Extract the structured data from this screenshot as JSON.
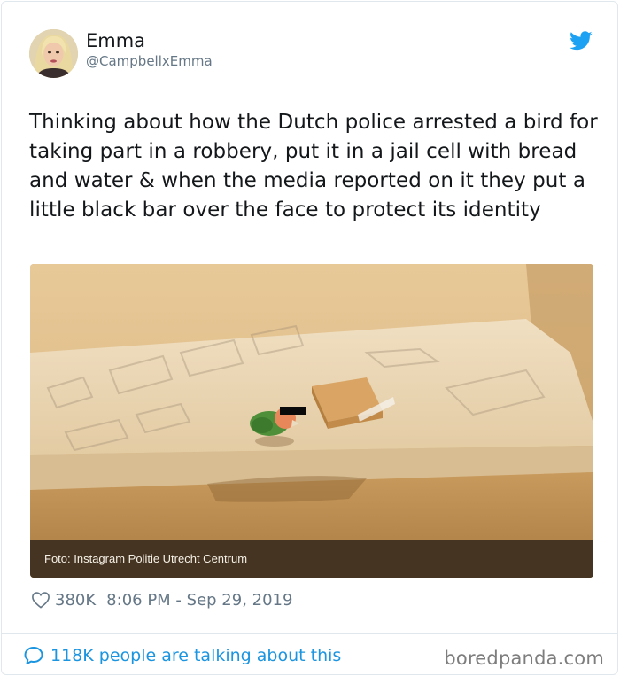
{
  "author": {
    "name": "Emma",
    "handle": "@CampbellxEmma"
  },
  "tweet": {
    "text": "Thinking about how the Dutch police arrested a bird for taking part in a robbery, put it in a jail cell with bread and water & when the media reported on it they put a little black bar over the face to protect its identity"
  },
  "media": {
    "caption": "Foto: Instagram Politie Utrecht Centrum"
  },
  "stats": {
    "likes": "380K",
    "timestamp": "8:06 PM - Sep 29, 2019"
  },
  "footer": {
    "talking": "118K people are talking about this",
    "watermark": "boredpanda.com"
  },
  "colors": {
    "link_blue": "#1b95e0",
    "twitter_blue": "#1da1f2",
    "muted_gray": "#657786"
  },
  "icons": {
    "brand": "twitter-bird-icon",
    "like": "heart-icon",
    "reply": "speech-bubble-icon"
  }
}
